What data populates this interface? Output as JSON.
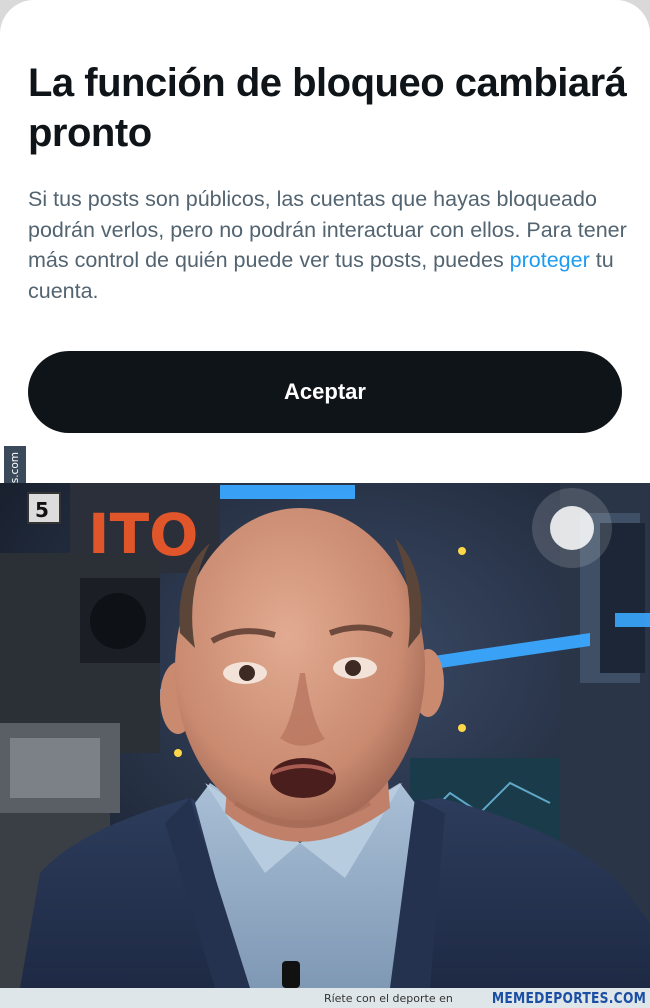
{
  "dialog": {
    "title": "La función de bloqueo cambiará pronto",
    "body_before_link": "Si tus posts son públicos, las cuentas que hayas bloqueado podrán verlos, pero no podrán interactuar con ellos. Para tener más control de quién puede ver tus posts, puedes ",
    "link_text": "proteger",
    "body_after_link": " tu cuenta.",
    "accept_label": "Aceptar"
  },
  "watermark": {
    "side_text": "Memedeportes.com",
    "tagline": "Ríete con el deporte en",
    "brand": "MEMEDEPORTES.COM"
  },
  "photo": {
    "studio_sign_text": "ITO",
    "camera_number": "5"
  },
  "colors": {
    "button_bg": "#0f1419",
    "link": "#1d9bf0",
    "body_text": "#536471"
  }
}
